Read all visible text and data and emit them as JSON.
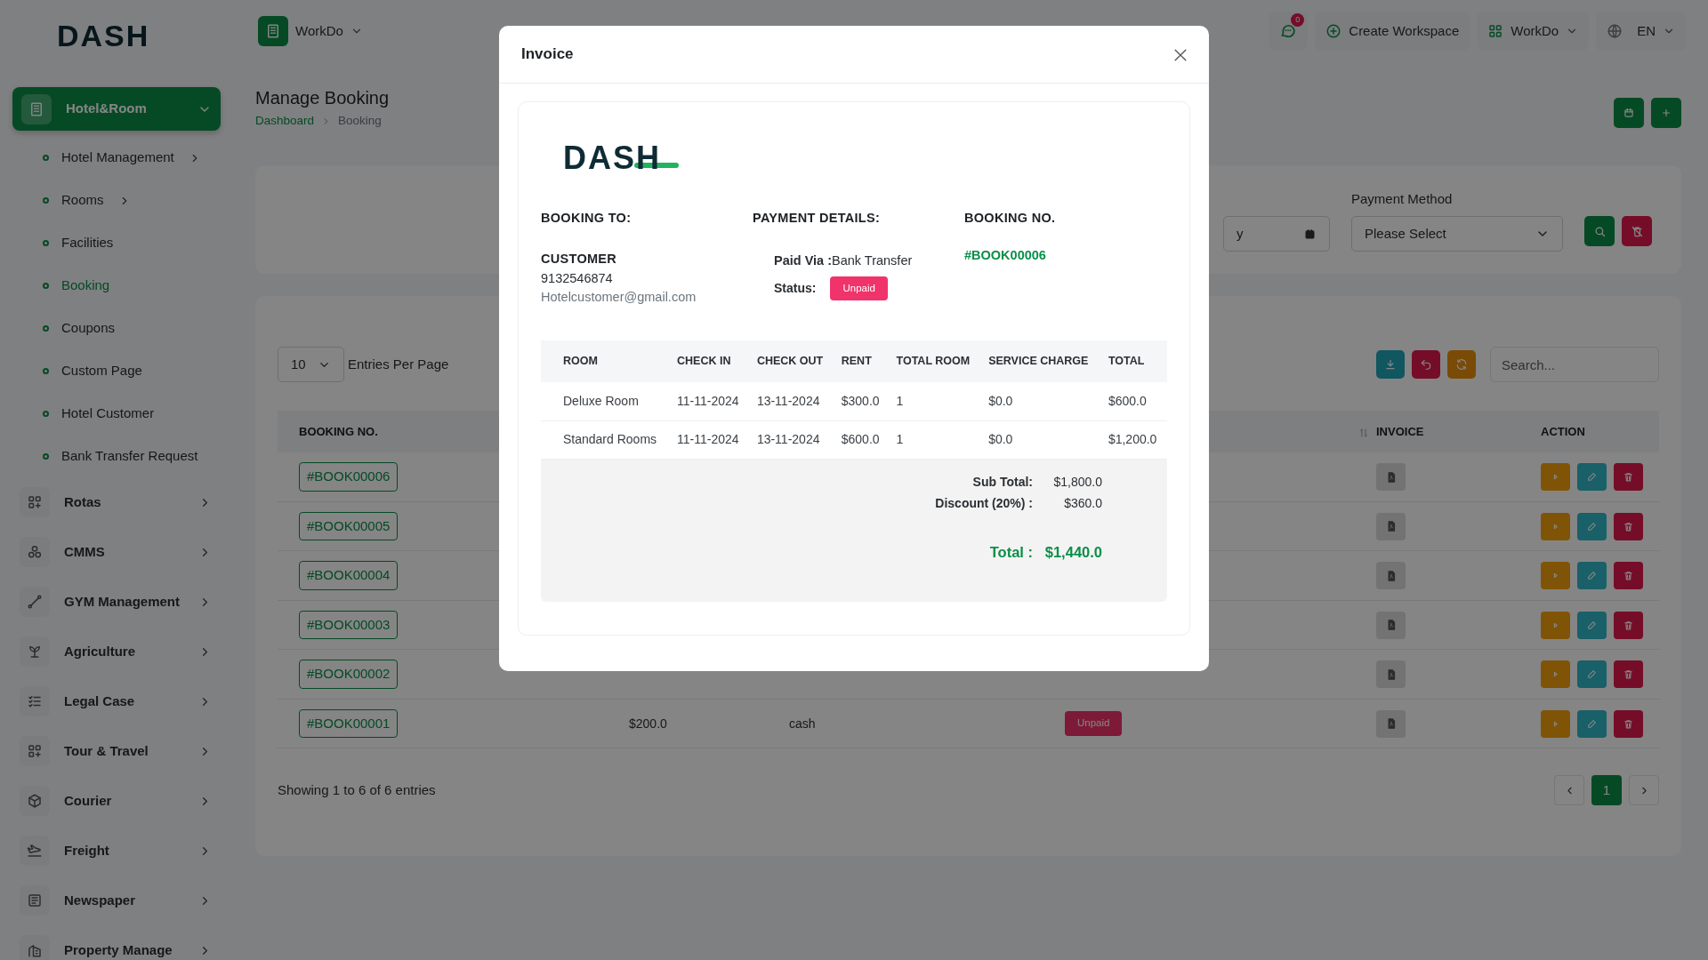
{
  "sidebar": {
    "logo": "DASH",
    "menu": [
      {
        "label": "Hotel&Room",
        "expanded": true,
        "selected": true,
        "children": [
          {
            "label": "Hotel Management",
            "submenu": true,
            "selected": false
          },
          {
            "label": "Rooms",
            "submenu": true,
            "selected": false
          },
          {
            "label": "Facilities",
            "submenu": false,
            "selected": false
          },
          {
            "label": "Booking",
            "submenu": false,
            "selected": true
          },
          {
            "label": "Coupons",
            "submenu": false,
            "selected": false
          },
          {
            "label": "Custom Page",
            "submenu": false,
            "selected": false
          },
          {
            "label": "Hotel Customer",
            "submenu": false,
            "selected": false
          },
          {
            "label": "Bank Transfer Request",
            "submenu": false,
            "selected": false
          }
        ]
      },
      {
        "label": "Rotas",
        "expanded": false,
        "selected": false
      },
      {
        "label": "CMMS",
        "expanded": false,
        "selected": false
      },
      {
        "label": "GYM Management",
        "expanded": false,
        "selected": false
      },
      {
        "label": "Agriculture",
        "expanded": false,
        "selected": false
      },
      {
        "label": "Legal Case",
        "expanded": false,
        "selected": false
      },
      {
        "label": "Tour & Travel",
        "expanded": false,
        "selected": false
      },
      {
        "label": "Courier",
        "expanded": false,
        "selected": false
      },
      {
        "label": "Freight",
        "expanded": false,
        "selected": false
      },
      {
        "label": "Newspaper",
        "expanded": false,
        "selected": false
      },
      {
        "label": "Property Manage",
        "expanded": false,
        "selected": false
      }
    ]
  },
  "header": {
    "workspace": "WorkDo",
    "notifications": "0",
    "create_workspace": "Create Workspace",
    "workspace_menu": "WorkDo",
    "language": "EN"
  },
  "page": {
    "title": "Manage Booking",
    "breadcrumb": [
      "Dashboard",
      "Booking"
    ]
  },
  "filter": {
    "date_value": "y",
    "payment_label": "Payment Method",
    "payment_placeholder": "Please Select"
  },
  "table": {
    "entries": "10",
    "entries_label": "Entries Per Page",
    "search_placeholder": "Search...",
    "columns": [
      "BOOKING NO.",
      "INVOICE",
      "ACTION"
    ],
    "rows": [
      {
        "booking": "#BOOK00006"
      },
      {
        "booking": "#BOOK00005"
      },
      {
        "booking": "#BOOK00004"
      },
      {
        "booking": "#BOOK00003"
      },
      {
        "booking": "#BOOK00002"
      },
      {
        "booking": "#BOOK00001",
        "amount": "$200.0",
        "method": "cash",
        "status": "Unpaid"
      }
    ],
    "footer": "Showing 1 to 6 of 6 entries",
    "pages": [
      {
        "label": "1",
        "selected": true
      }
    ]
  },
  "modal": {
    "title": "Invoice",
    "logo": "DASH",
    "booking_to": {
      "heading": "BOOKING TO:",
      "name": "CUSTOMER",
      "phone": "9132546874",
      "email": "Hotelcustomer@gmail.com"
    },
    "payment": {
      "heading": "PAYMENT DETAILS:",
      "paid_via_label": "Paid Via :",
      "paid_via": "Bank Transfer",
      "status_label": "Status:",
      "status": "Unpaid",
      "color": "#f0336a"
    },
    "booking_no": {
      "heading": "BOOKING NO.",
      "value": "#BOOK00006"
    },
    "columns": [
      "ROOM",
      "CHECK IN",
      "CHECK OUT",
      "RENT",
      "TOTAL ROOM",
      "SERVICE CHARGE",
      "TOTAL"
    ],
    "rows": [
      [
        "Deluxe Room",
        "11-11-2024",
        "13-11-2024",
        "$300.0",
        "1",
        "$0.0",
        "$600.0"
      ],
      [
        "Standard Rooms",
        "11-11-2024",
        "13-11-2024",
        "$600.0",
        "1",
        "$0.0",
        "$1,200.0"
      ]
    ],
    "summary": [
      {
        "label": "Sub Total:",
        "value": "$1,800.0",
        "kind": "line"
      },
      {
        "label": "Discount (20%) :",
        "value": "$360.0",
        "kind": "line"
      },
      {
        "label": "Total :",
        "value": "$1,440.0",
        "kind": "total"
      }
    ]
  }
}
